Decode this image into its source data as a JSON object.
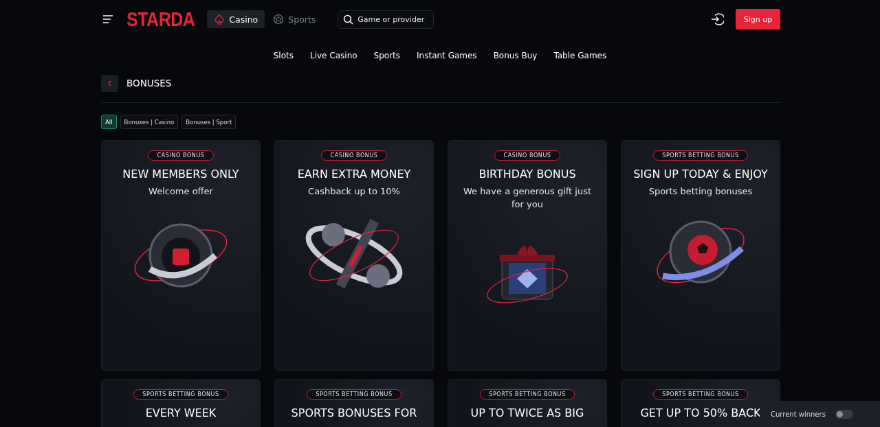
{
  "header": {
    "logo": "STARDA",
    "modes": [
      {
        "label": "Casino",
        "kind": "spade",
        "selected": true
      },
      {
        "label": "Sports",
        "kind": "ball",
        "selected": false
      }
    ],
    "search": {
      "placeholder": "Game or provider"
    },
    "signup": "Sign up"
  },
  "nav": [
    "Slots",
    "Live Casino",
    "Sports",
    "Instant Games",
    "Bonus Buy",
    "Table Games"
  ],
  "page_title": "BONUSES",
  "filters": [
    {
      "label": "All",
      "selected": true
    },
    {
      "label": "Bonuses | Casino",
      "selected": false
    },
    {
      "label": "Bonuses | Sport",
      "selected": false
    }
  ],
  "cards": [
    {
      "tag": "CASINO BONUS",
      "title": "NEW MEMBERS ONLY",
      "subtitle": "Welcome offer",
      "kind": "sphere"
    },
    {
      "tag": "CASINO BONUS",
      "title": "EARN EXTRA MONEY",
      "subtitle": "Cashback up to 10%",
      "kind": "cashback"
    },
    {
      "tag": "CASINO BONUS",
      "title": "BIRTHDAY BONUS",
      "subtitle": "We have a generous gift just for you",
      "kind": "gift"
    },
    {
      "tag": "SPORTS BETTING BONUS",
      "title": "SIGN UP TODAY & ENJOY",
      "subtitle": "Sports betting bonuses",
      "kind": "ball"
    },
    {
      "tag": "SPORTS BETTING BONUS",
      "title": "EVERY WEEK"
    },
    {
      "tag": "SPORTS BETTING BONUS",
      "title": "SPORTS BONUSES FOR"
    },
    {
      "tag": "SPORTS BETTING BONUS",
      "title": "UP TO TWICE AS BIG"
    },
    {
      "tag": "SPORTS BETTING BONUS",
      "title": "GET UP TO 50% BACK"
    }
  ],
  "winners": {
    "label": "Current winners",
    "on": false
  }
}
